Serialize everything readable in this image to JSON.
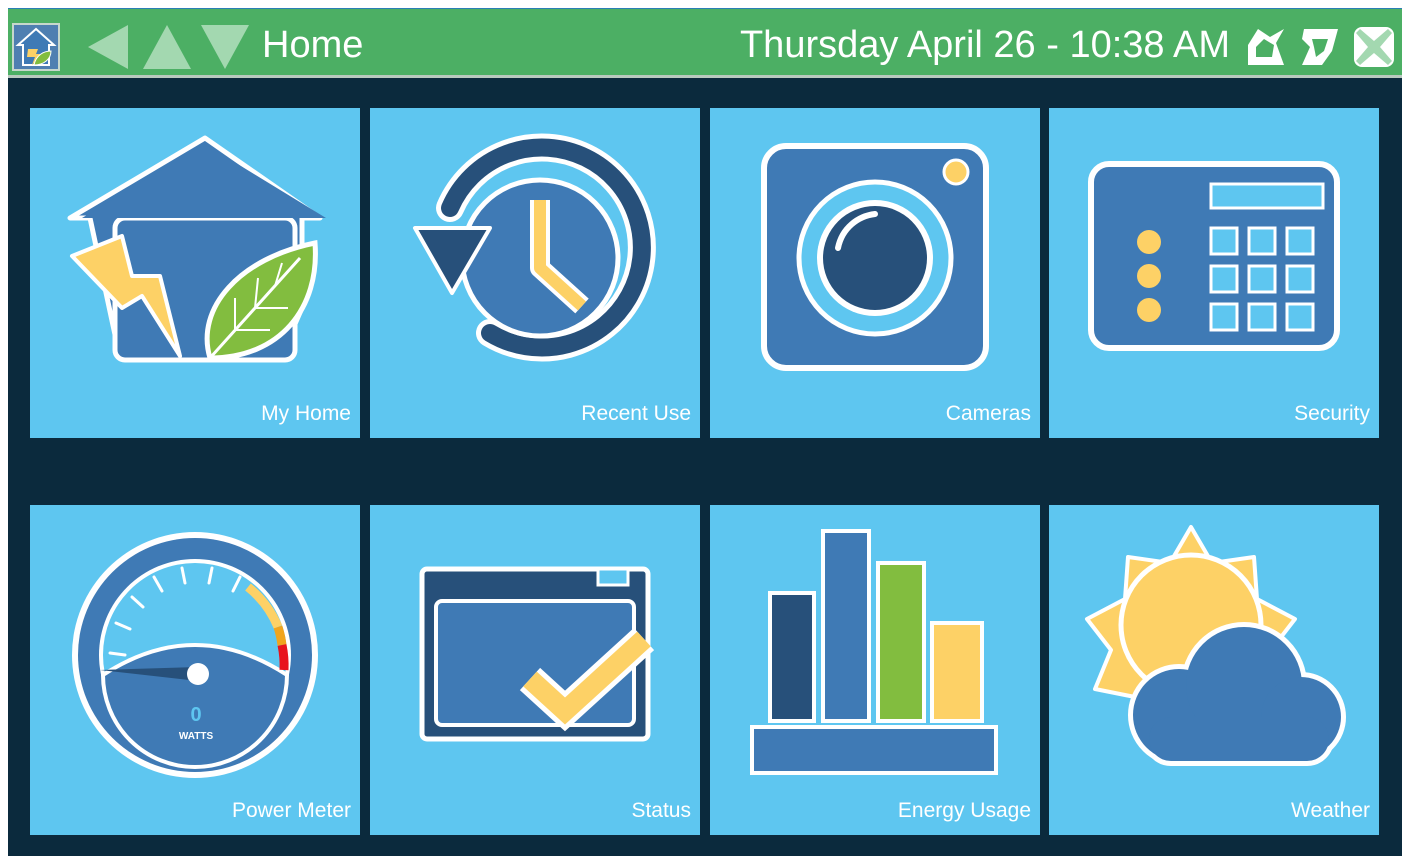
{
  "header": {
    "title": "Home",
    "datetime": "Thursday April 26 - 10:38 AM",
    "nav_icons": [
      "home-icon",
      "back-arrow-icon",
      "up-arrow-icon",
      "down-arrow-icon"
    ],
    "tool_icons": [
      "export-icon",
      "share-icon",
      "close-icon"
    ]
  },
  "tiles": [
    {
      "label": "My Home",
      "icon": "house-energy-leaf-icon"
    },
    {
      "label": "Recent Use",
      "icon": "history-clock-icon"
    },
    {
      "label": "Cameras",
      "icon": "camera-icon"
    },
    {
      "label": "Security",
      "icon": "security-keypad-icon"
    },
    {
      "label": "Power Meter",
      "icon": "power-gauge-icon"
    },
    {
      "label": "Status",
      "icon": "status-check-icon"
    },
    {
      "label": "Energy Usage",
      "icon": "bar-chart-icon"
    },
    {
      "label": "Weather",
      "icon": "sun-cloud-icon"
    }
  ],
  "power_meter": {
    "value": "0",
    "unit": "WATTS"
  },
  "colors": {
    "header_bg": "#4caf64",
    "app_bg": "#0b2a3d",
    "tile_bg": "#5ec6f0",
    "icon_blue": "#3f7ab5",
    "icon_navy": "#27507a",
    "accent_yellow": "#fdd166",
    "accent_green": "#82bd3f"
  }
}
